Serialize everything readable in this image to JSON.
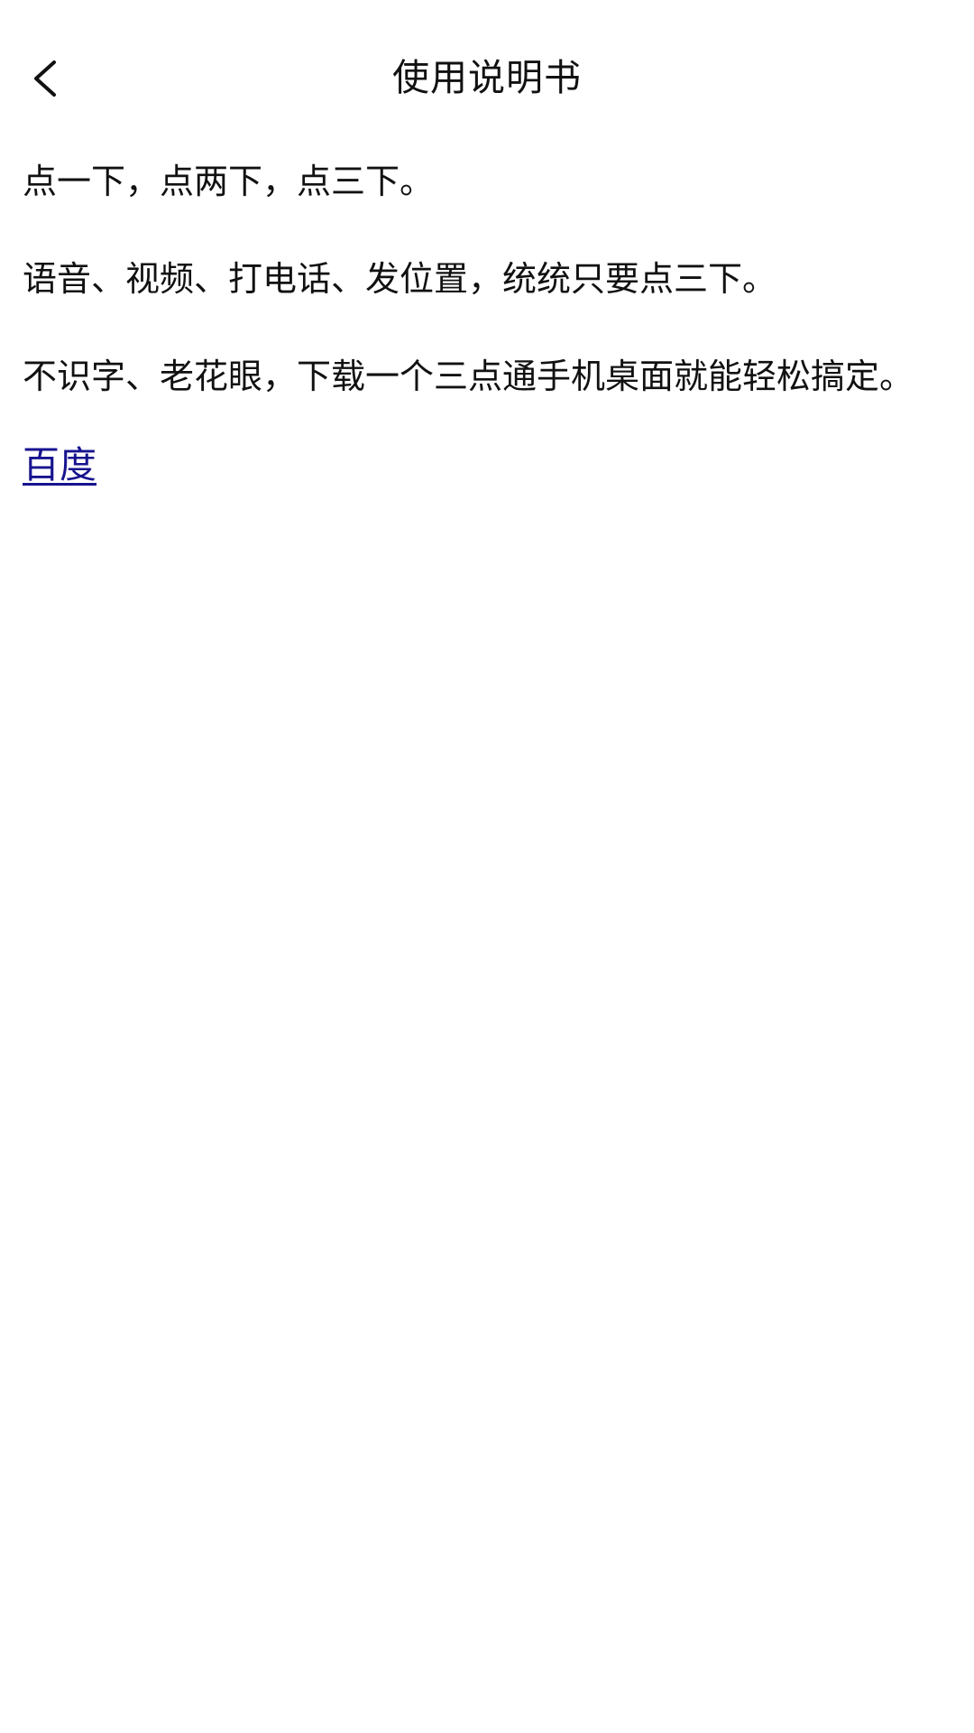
{
  "header": {
    "title": "使用说明书",
    "back_icon": "chevron-left-icon"
  },
  "content": {
    "paragraphs": [
      "点一下，点两下，点三下。",
      "语音、视频、打电话、发位置，统统只要点三下。",
      "不识字、老花眼，下载一个三点通手机桌面就能轻松搞定。"
    ],
    "link_text": "百度"
  },
  "colors": {
    "background": "#ffffff",
    "text": "#111111",
    "link": "#17138f"
  }
}
